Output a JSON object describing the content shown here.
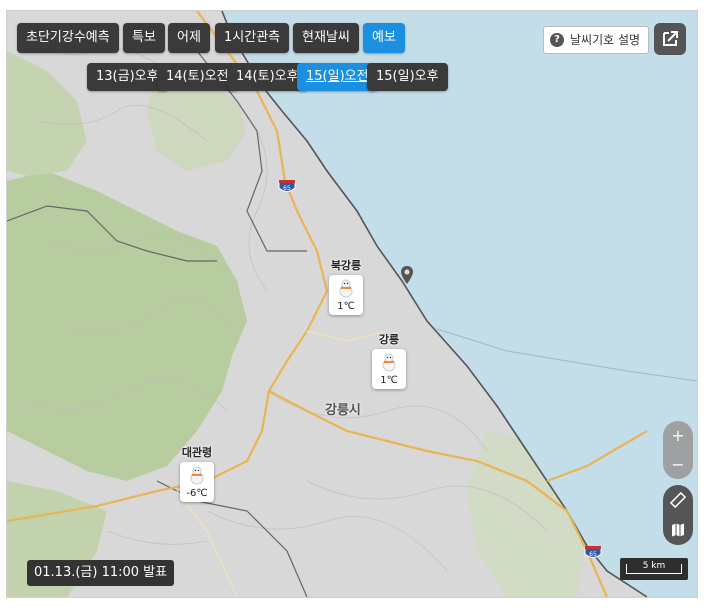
{
  "tabs": [
    {
      "label": "초단기강수예측",
      "active": false
    },
    {
      "label": "특보",
      "active": false
    },
    {
      "label": "어제",
      "active": false
    },
    {
      "label": "1시간관측",
      "active": false
    },
    {
      "label": "현재날씨",
      "active": false
    },
    {
      "label": "예보",
      "active": true
    }
  ],
  "times": [
    {
      "label": "13(금)오후",
      "active": false
    },
    {
      "label": "14(토)오전",
      "active": false
    },
    {
      "label": "14(토)오후",
      "active": false
    },
    {
      "label": "15(일)오전",
      "active": true
    },
    {
      "label": "15(일)오후",
      "active": false
    }
  ],
  "legend_label": "날씨기호 설명",
  "legend_q": "?",
  "stations": [
    {
      "name": "북강릉",
      "temp": "1℃",
      "icon": "snowman-icon"
    },
    {
      "name": "강릉",
      "temp": "1℃",
      "icon": "snowman-icon"
    },
    {
      "name": "대관령",
      "temp": "-6℃",
      "icon": "snowman-icon"
    }
  ],
  "place_label": "강릉시",
  "highway_number": "65",
  "zoom": {
    "in": "+",
    "out": "−"
  },
  "issued": "01.13.(금) 11:00 발표",
  "scale": "5 km",
  "colors": {
    "active": "#1b8fe0",
    "button": "#3a3a3a",
    "sea": "#c3dde9",
    "forest": "#b5cc9b",
    "road": "#e9b454"
  }
}
